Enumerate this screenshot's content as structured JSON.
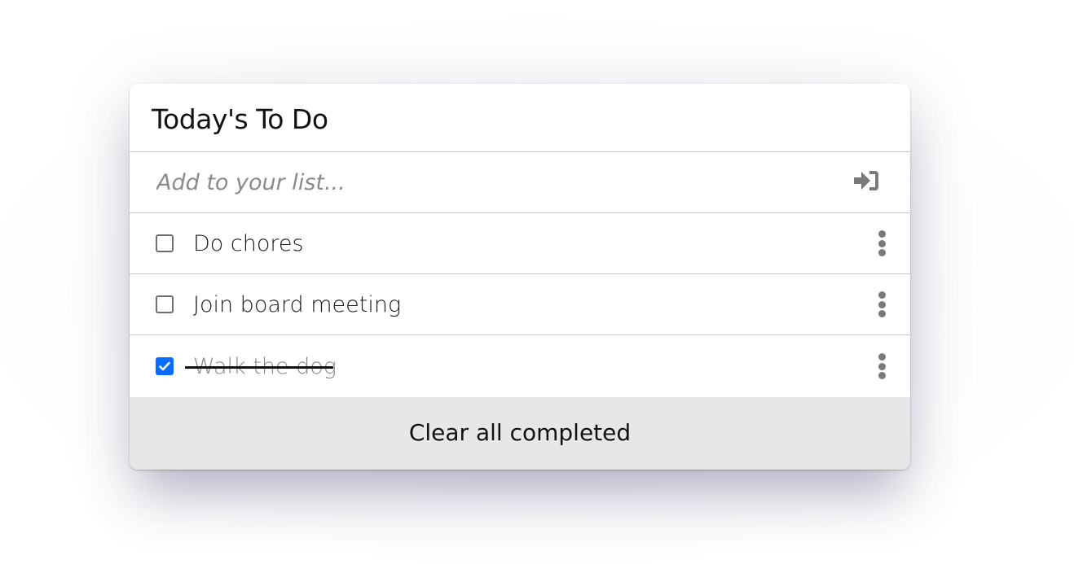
{
  "card": {
    "title": "Today's To Do"
  },
  "add": {
    "placeholder": "Add to your list...",
    "value": "",
    "icon": "sign-in-icon"
  },
  "items": [
    {
      "label": "Do chores",
      "completed": false
    },
    {
      "label": "Join board meeting",
      "completed": false
    },
    {
      "label": "Walk the dog",
      "completed": true
    }
  ],
  "footer": {
    "clear_label": "Clear all completed"
  },
  "colors": {
    "accent": "#0a6cff",
    "icon_gray": "#7a7a7a",
    "footer_bg": "#e7e7e7"
  }
}
